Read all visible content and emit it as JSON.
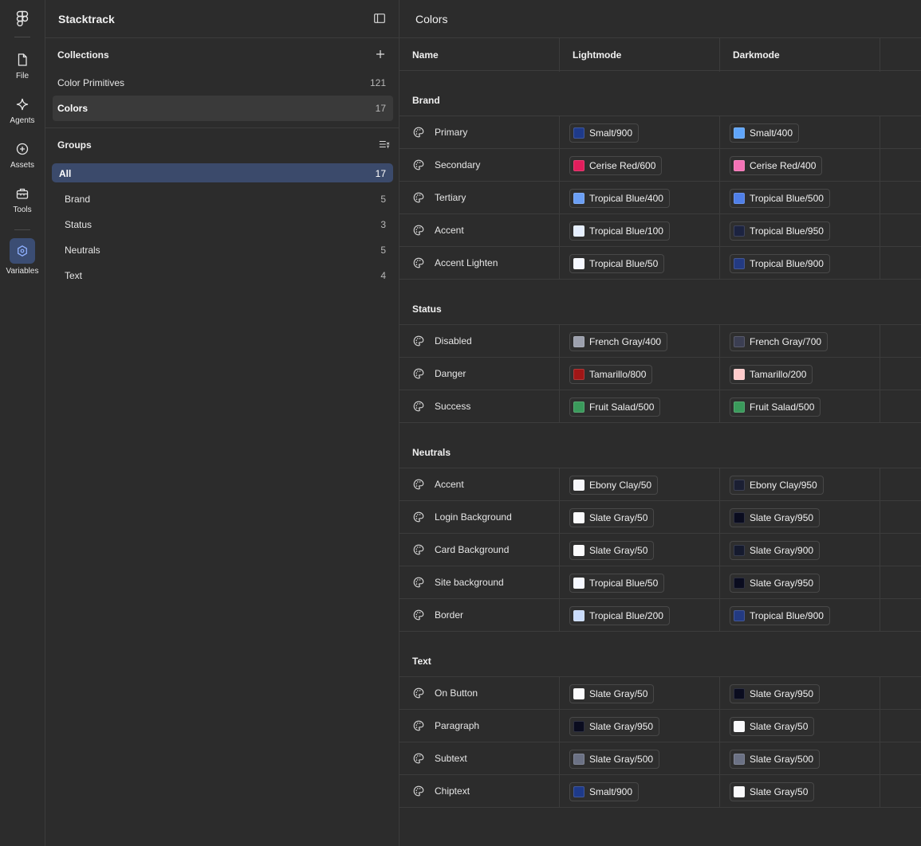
{
  "rail": {
    "items": [
      {
        "label": "File",
        "icon": "file-icon"
      },
      {
        "label": "Agents",
        "icon": "sparkle-icon"
      },
      {
        "label": "Assets",
        "icon": "plus-circle-icon"
      },
      {
        "label": "Tools",
        "icon": "toolbox-icon"
      },
      {
        "label": "Variables",
        "icon": "hexagon-icon",
        "active": true
      }
    ]
  },
  "panel": {
    "title": "Stacktrack",
    "collections": {
      "title": "Collections",
      "items": [
        {
          "name": "Color Primitives",
          "count": "121",
          "selected": false
        },
        {
          "name": "Colors",
          "count": "17",
          "selected": true
        }
      ]
    },
    "groups": {
      "title": "Groups",
      "items": [
        {
          "name": "All",
          "count": "17",
          "selected": true
        },
        {
          "name": "Brand",
          "count": "5",
          "selected": false
        },
        {
          "name": "Status",
          "count": "3",
          "selected": false
        },
        {
          "name": "Neutrals",
          "count": "5",
          "selected": false
        },
        {
          "name": "Text",
          "count": "4",
          "selected": false
        }
      ]
    }
  },
  "main": {
    "title": "Colors",
    "columns": {
      "name": "Name",
      "light": "Lightmode",
      "dark": "Darkmode"
    },
    "groups": [
      {
        "title": "Brand",
        "rows": [
          {
            "name": "Primary",
            "light": {
              "label": "Smalt/900",
              "color": "#1e3a8a"
            },
            "dark": {
              "label": "Smalt/400",
              "color": "#60a5fa"
            }
          },
          {
            "name": "Secondary",
            "light": {
              "label": "Cerise Red/600",
              "color": "#e11d5c"
            },
            "dark": {
              "label": "Cerise Red/400",
              "color": "#f472b6"
            }
          },
          {
            "name": "Tertiary",
            "light": {
              "label": "Tropical Blue/400",
              "color": "#6b9ff5"
            },
            "dark": {
              "label": "Tropical Blue/500",
              "color": "#4f7fe8"
            }
          },
          {
            "name": "Accent",
            "light": {
              "label": "Tropical Blue/100",
              "color": "#e6efff"
            },
            "dark": {
              "label": "Tropical Blue/950",
              "color": "#1c2340"
            }
          },
          {
            "name": "Accent Lighten",
            "light": {
              "label": "Tropical Blue/50",
              "color": "#f5f8ff"
            },
            "dark": {
              "label": "Tropical Blue/900",
              "color": "#233a82"
            }
          }
        ]
      },
      {
        "title": "Status",
        "rows": [
          {
            "name": "Disabled",
            "light": {
              "label": "French Gray/400",
              "color": "#9ca0ad"
            },
            "dark": {
              "label": "French Gray/700",
              "color": "#3b3e52"
            }
          },
          {
            "name": "Danger",
            "light": {
              "label": "Tamarillo/800",
              "color": "#a01616"
            },
            "dark": {
              "label": "Tamarillo/200",
              "color": "#fecaca"
            }
          },
          {
            "name": "Success",
            "light": {
              "label": "Fruit Salad/500",
              "color": "#3a9a5b"
            },
            "dark": {
              "label": "Fruit Salad/500",
              "color": "#3a9a5b"
            }
          }
        ]
      },
      {
        "title": "Neutrals",
        "rows": [
          {
            "name": "Accent",
            "light": {
              "label": "Ebony Clay/50",
              "color": "#f7f7fa"
            },
            "dark": {
              "label": "Ebony Clay/950",
              "color": "#1b1f33"
            }
          },
          {
            "name": "Login Background",
            "light": {
              "label": "Slate Gray/50",
              "color": "#fafafc"
            },
            "dark": {
              "label": "Slate Gray/950",
              "color": "#0a0c1f"
            }
          },
          {
            "name": "Card Background",
            "light": {
              "label": "Slate Gray/50",
              "color": "#fafafc"
            },
            "dark": {
              "label": "Slate Gray/900",
              "color": "#151a2e"
            }
          },
          {
            "name": "Site background",
            "light": {
              "label": "Tropical Blue/50",
              "color": "#f5f8ff"
            },
            "dark": {
              "label": "Slate Gray/950",
              "color": "#0a0c1f"
            }
          },
          {
            "name": "Border",
            "light": {
              "label": "Tropical Blue/200",
              "color": "#cadcfc"
            },
            "dark": {
              "label": "Tropical Blue/900",
              "color": "#233a82"
            }
          }
        ]
      },
      {
        "title": "Text",
        "rows": [
          {
            "name": "On Button",
            "light": {
              "label": "Slate Gray/50",
              "color": "#fafafc"
            },
            "dark": {
              "label": "Slate Gray/950",
              "color": "#0a0c1f"
            }
          },
          {
            "name": "Paragraph",
            "light": {
              "label": "Slate Gray/950",
              "color": "#0a0c1f"
            },
            "dark": {
              "label": "Slate Gray/50",
              "color": "#fafafc"
            }
          },
          {
            "name": "Subtext",
            "light": {
              "label": "Slate Gray/500",
              "color": "#6b7184"
            },
            "dark": {
              "label": "Slate Gray/500",
              "color": "#6b7184"
            }
          },
          {
            "name": "Chiptext",
            "light": {
              "label": "Smalt/900",
              "color": "#1e3a8a"
            },
            "dark": {
              "label": "Slate Gray/50",
              "color": "#fafafc"
            }
          }
        ]
      }
    ]
  }
}
